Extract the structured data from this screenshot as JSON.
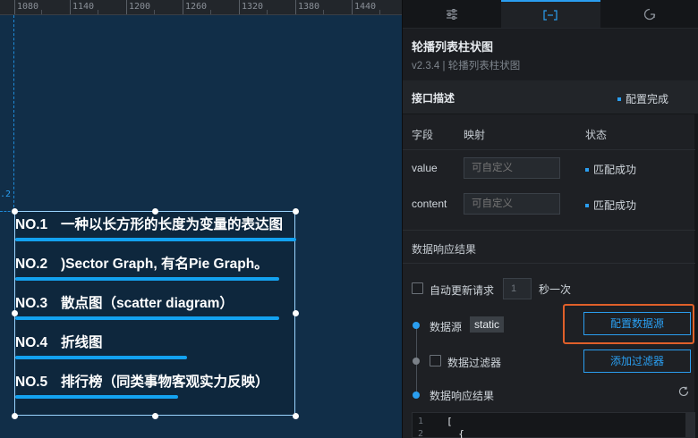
{
  "ruler": {
    "labels": [
      "1080",
      "1140",
      "1200",
      "1260",
      "1320",
      "1380",
      "1440"
    ]
  },
  "guide": {
    "label": ".2"
  },
  "widget": {
    "rows": [
      {
        "no": "NO.1",
        "text": "一种以长方形的长度为变量的表达图",
        "bar_fraction": 1.0
      },
      {
        "no": "NO.2",
        "text": ")Sector Graph, 有名Pie Graph。",
        "bar_fraction": 0.94
      },
      {
        "no": "NO.3",
        "text": "散点图（scatter diagram）",
        "bar_fraction": 0.94
      },
      {
        "no": "NO.4",
        "text": "折线图",
        "bar_fraction": 0.61
      },
      {
        "no": "NO.5",
        "text": "排行榜（同类事物客观实力反映）",
        "bar_fraction": 0.58
      }
    ],
    "bar_color": "#13a2f0"
  },
  "panel": {
    "tabs": [
      {
        "name": "style-settings",
        "icon": "sliders-icon",
        "active": false
      },
      {
        "name": "data-settings",
        "icon": "bracket-icon",
        "active": true
      },
      {
        "name": "interaction-settings",
        "icon": "interaction-icon",
        "active": false
      }
    ],
    "title": "轮播列表柱状图",
    "version": "v2.3.4 | 轮播列表柱状图",
    "api_section": {
      "title": "接口描述",
      "status": "配置完成",
      "headers": {
        "field": "字段",
        "mapping": "映射",
        "state": "状态"
      },
      "fields": [
        {
          "name": "value",
          "placeholder": "可自定义",
          "status": "匹配成功"
        },
        {
          "name": "content",
          "placeholder": "可自定义",
          "status": "匹配成功"
        }
      ]
    },
    "response": {
      "title": "数据响应结果",
      "auto_update_label": "自动更新请求",
      "interval_value": "1",
      "interval_suffix": "秒一次",
      "datasource_label": "数据源",
      "datasource_tag": "static",
      "config_datasource_button": "配置数据源",
      "filter_label": "数据过滤器",
      "add_filter_button": "添加过滤器",
      "result_label": "数据响应结果"
    },
    "code": {
      "lines": [
        {
          "no": "1",
          "text": "["
        },
        {
          "no": "2",
          "text": "  {"
        }
      ]
    }
  },
  "colors": {
    "accent": "#2a9ef0",
    "highlight": "#e0602a",
    "canvas_bg": "#112e48"
  }
}
